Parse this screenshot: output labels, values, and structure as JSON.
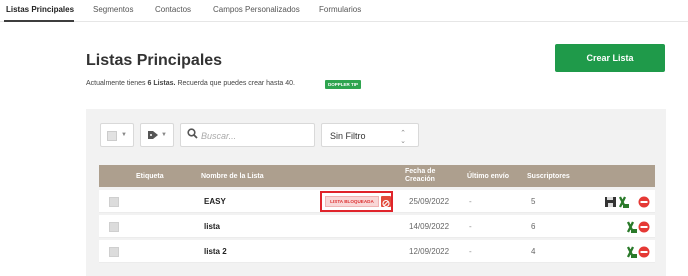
{
  "nav": {
    "tabs": [
      {
        "label": "Listas Principales"
      },
      {
        "label": "Segmentos"
      },
      {
        "label": "Contactos"
      },
      {
        "label": "Campos Personalizados"
      },
      {
        "label": "Formularios"
      }
    ]
  },
  "header": {
    "title": "Listas Principales",
    "subtitle_prefix": "Actualmente tienes ",
    "subtitle_count": "6 Listas.",
    "subtitle_suffix": " Recuerda que puedes crear hasta 40.",
    "tip_badge": "DOPPLER TIP",
    "create_button": "Crear Lista"
  },
  "toolbar": {
    "search_placeholder": "Buscar...",
    "filter_value": "Sin Filtro"
  },
  "table": {
    "headers": {
      "tag": "Etiqueta",
      "name": "Nombre de la Lista",
      "created_line1": "Fecha de",
      "created_line2": "Creación",
      "last_send": "Último envío",
      "subscribers": "Suscriptores"
    },
    "rows": [
      {
        "name": "EASY",
        "blocked_label": "LISTA BLOQUEADA",
        "created": "25/09/2022",
        "last_send": "-",
        "subscribers": "5"
      },
      {
        "name": "lista",
        "created": "14/09/2022",
        "last_send": "-",
        "subscribers": "6"
      },
      {
        "name": "lista 2",
        "created": "12/09/2022",
        "last_send": "-",
        "subscribers": "4"
      }
    ]
  },
  "colors": {
    "brand_green": "#1f9a4a",
    "table_header": "#ad9f8e",
    "danger": "#e0242b"
  },
  "icons": [
    "checkbox-icon",
    "tag-icon",
    "search-icon",
    "blocked-icon",
    "save-icon",
    "excel-icon",
    "delete-icon"
  ]
}
